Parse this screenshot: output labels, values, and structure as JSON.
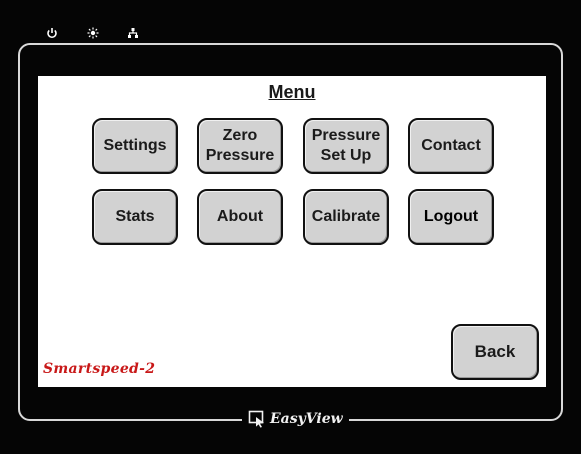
{
  "menu": {
    "title": "Menu"
  },
  "buttons": {
    "settings": "Settings",
    "zero_pressure": "Zero\nPressure",
    "pressure_setup": "Pressure\nSet Up",
    "contact": "Contact",
    "stats": "Stats",
    "about": "About",
    "calibrate": "Calibrate",
    "logout": "Logout",
    "back": "Back"
  },
  "branding": {
    "product": "Smartspeed-2",
    "device_logo": "EasyView"
  },
  "indicators": [
    {
      "icon": "power-icon"
    },
    {
      "icon": "sun-icon"
    },
    {
      "icon": "network-icon"
    }
  ],
  "colors": {
    "bezel": "#050505",
    "screen": "#ffffff",
    "button": "#d2d2d2",
    "brand_red": "#c81818"
  }
}
